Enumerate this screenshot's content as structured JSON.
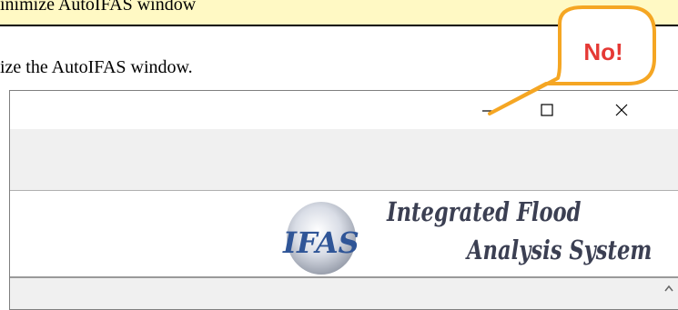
{
  "header": {
    "title": "inimize AutoIFAS window"
  },
  "instruction": {
    "text": "ize the AutoIFAS window."
  },
  "callout": {
    "text": "No!"
  },
  "window": {
    "logo": {
      "acronym": "IFAS",
      "line1": "Integrated Flood",
      "line2": "Analysis System"
    },
    "caption_buttons": [
      "minimize",
      "maximize",
      "close"
    ]
  },
  "colors": {
    "header_band": "#fff9c4",
    "callout_border": "#f5a623",
    "callout_text": "#e53935"
  }
}
